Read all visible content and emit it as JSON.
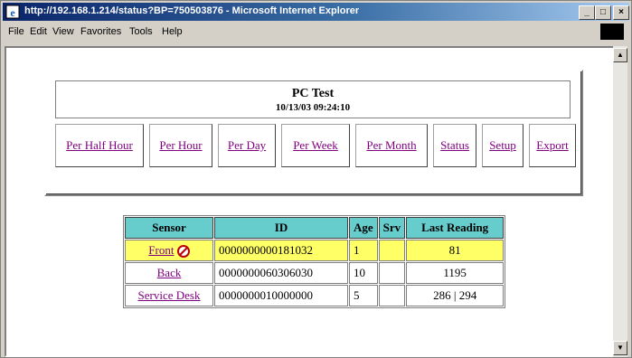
{
  "window": {
    "title": "http://192.168.1.214/status?BP=750503876 - Microsoft Internet Explorer",
    "minimize": "_",
    "maximize": "□",
    "close": "×"
  },
  "menubar": {
    "items": [
      "File",
      "Edit",
      "View",
      "Favorites",
      "Tools",
      "Help"
    ]
  },
  "header": {
    "title": "PC Test",
    "datetime": "10/13/03 09:24:10"
  },
  "nav": {
    "buttons": [
      "Per Half Hour",
      "Per Hour",
      "Per Day",
      "Per Week",
      "Per Month",
      "Status",
      "Setup",
      "Export"
    ]
  },
  "table": {
    "headers": [
      "Sensor",
      "ID",
      "Age",
      "Srv",
      "Last Reading"
    ],
    "rows": [
      {
        "sensor": "Front",
        "id": "0000000000181032",
        "age": "1",
        "srv": "",
        "reading": "81",
        "alert": true
      },
      {
        "sensor": "Back",
        "id": "0000000060306030",
        "age": "10",
        "srv": "",
        "reading": "1195",
        "alert": false
      },
      {
        "sensor": "Service Desk",
        "id": "0000000010000000",
        "age": "5",
        "srv": "",
        "reading": "286 | 294",
        "alert": false
      }
    ]
  },
  "colors": {
    "header_cell": "#66cccc",
    "alert_row": "#ffff66",
    "link": "#800080"
  },
  "icons": [
    "ie-icon",
    "alert-icon",
    "scroll-up-icon",
    "scroll-down-icon"
  ]
}
